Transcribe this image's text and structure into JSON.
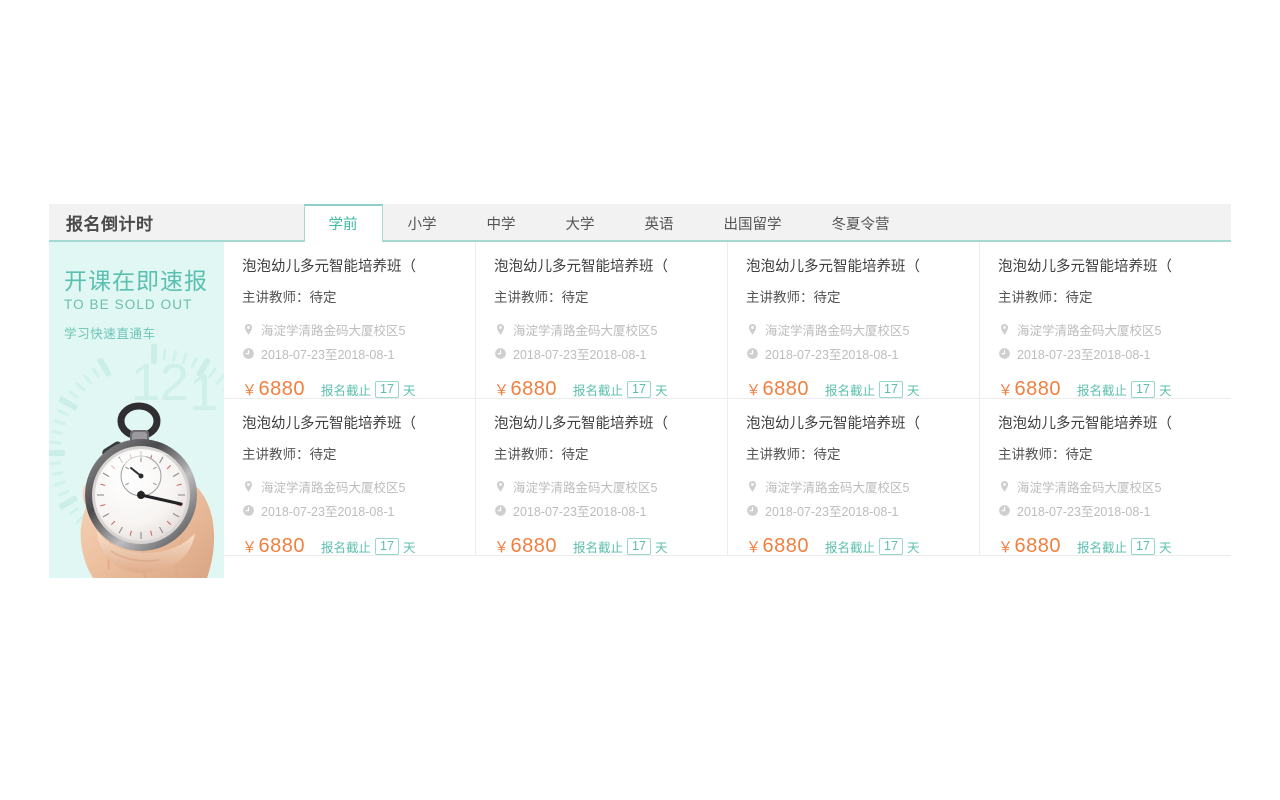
{
  "header": {
    "title": "报名倒计时"
  },
  "tabs": [
    {
      "label": "学前",
      "active": true
    },
    {
      "label": "小学",
      "active": false
    },
    {
      "label": "中学",
      "active": false
    },
    {
      "label": "大学",
      "active": false
    },
    {
      "label": "英语",
      "active": false
    },
    {
      "label": "出国留学",
      "active": false
    },
    {
      "label": "冬夏令营",
      "active": false
    }
  ],
  "promo": {
    "headline": "开课在即速报",
    "subhead": "TO BE SOLD OUT",
    "tagline": "学习快速直通车",
    "image_name": "hand-holding-stopwatch",
    "background_color": "#e0f7f3",
    "accent_color": "#5bc0b0"
  },
  "cards": [
    {
      "title": "泡泡幼儿多元智能培养班（",
      "teacher": "主讲教师：待定",
      "address": "海淀学清路金码大厦校区5",
      "date_range": "2018-07-23至2018-08-1",
      "currency": "￥",
      "price": "6880",
      "deadline_prefix": "报名截止",
      "deadline_days": "17",
      "deadline_suffix": "天"
    },
    {
      "title": "泡泡幼儿多元智能培养班（",
      "teacher": "主讲教师：待定",
      "address": "海淀学清路金码大厦校区5",
      "date_range": "2018-07-23至2018-08-1",
      "currency": "￥",
      "price": "6880",
      "deadline_prefix": "报名截止",
      "deadline_days": "17",
      "deadline_suffix": "天"
    },
    {
      "title": "泡泡幼儿多元智能培养班（",
      "teacher": "主讲教师：待定",
      "address": "海淀学清路金码大厦校区5",
      "date_range": "2018-07-23至2018-08-1",
      "currency": "￥",
      "price": "6880",
      "deadline_prefix": "报名截止",
      "deadline_days": "17",
      "deadline_suffix": "天"
    },
    {
      "title": "泡泡幼儿多元智能培养班（",
      "teacher": "主讲教师：待定",
      "address": "海淀学清路金码大厦校区5",
      "date_range": "2018-07-23至2018-08-1",
      "currency": "￥",
      "price": "6880",
      "deadline_prefix": "报名截止",
      "deadline_days": "17",
      "deadline_suffix": "天"
    },
    {
      "title": "泡泡幼儿多元智能培养班（",
      "teacher": "主讲教师：待定",
      "address": "海淀学清路金码大厦校区5",
      "date_range": "2018-07-23至2018-08-1",
      "currency": "￥",
      "price": "6880",
      "deadline_prefix": "报名截止",
      "deadline_days": "17",
      "deadline_suffix": "天"
    },
    {
      "title": "泡泡幼儿多元智能培养班（",
      "teacher": "主讲教师：待定",
      "address": "海淀学清路金码大厦校区5",
      "date_range": "2018-07-23至2018-08-1",
      "currency": "￥",
      "price": "6880",
      "deadline_prefix": "报名截止",
      "deadline_days": "17",
      "deadline_suffix": "天"
    },
    {
      "title": "泡泡幼儿多元智能培养班（",
      "teacher": "主讲教师：待定",
      "address": "海淀学清路金码大厦校区5",
      "date_range": "2018-07-23至2018-08-1",
      "currency": "￥",
      "price": "6880",
      "deadline_prefix": "报名截止",
      "deadline_days": "17",
      "deadline_suffix": "天"
    },
    {
      "title": "泡泡幼儿多元智能培养班（",
      "teacher": "主讲教师：待定",
      "address": "海淀学清路金码大厦校区5",
      "date_range": "2018-07-23至2018-08-1",
      "currency": "￥",
      "price": "6880",
      "deadline_prefix": "报名截止",
      "deadline_days": "17",
      "deadline_suffix": "天"
    }
  ]
}
